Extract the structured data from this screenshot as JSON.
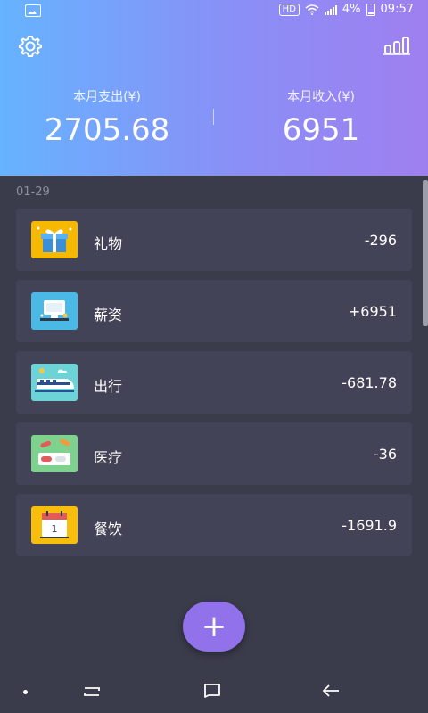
{
  "status": {
    "hd": "HD",
    "battery": "4%",
    "time": "09:57"
  },
  "summary": {
    "expense_label": "本月支出(¥)",
    "expense_value": "2705.68",
    "income_label": "本月收入(¥)",
    "income_value": "6951"
  },
  "date": "01-29",
  "records": [
    {
      "name": "礼物",
      "amount": "-296",
      "icon": "gift-icon",
      "color": "#f6b800"
    },
    {
      "name": "薪资",
      "amount": "+6951",
      "icon": "salary-icon",
      "color": "#4bb9e6"
    },
    {
      "name": "出行",
      "amount": "-681.78",
      "icon": "train-icon",
      "color": "#6cd3d6"
    },
    {
      "name": "医疗",
      "amount": "-36",
      "icon": "medical-icon",
      "color": "#7fd28d"
    },
    {
      "name": "餐饮",
      "amount": "-1691.9",
      "icon": "calendar-food-icon",
      "color": "#f7be0c"
    }
  ],
  "fab": "+",
  "colors": {
    "header_start": "#66b3ff",
    "header_end": "#9f7ff0",
    "background": "#3a3b4b",
    "card": "#424356",
    "fab": "#9172eb"
  }
}
